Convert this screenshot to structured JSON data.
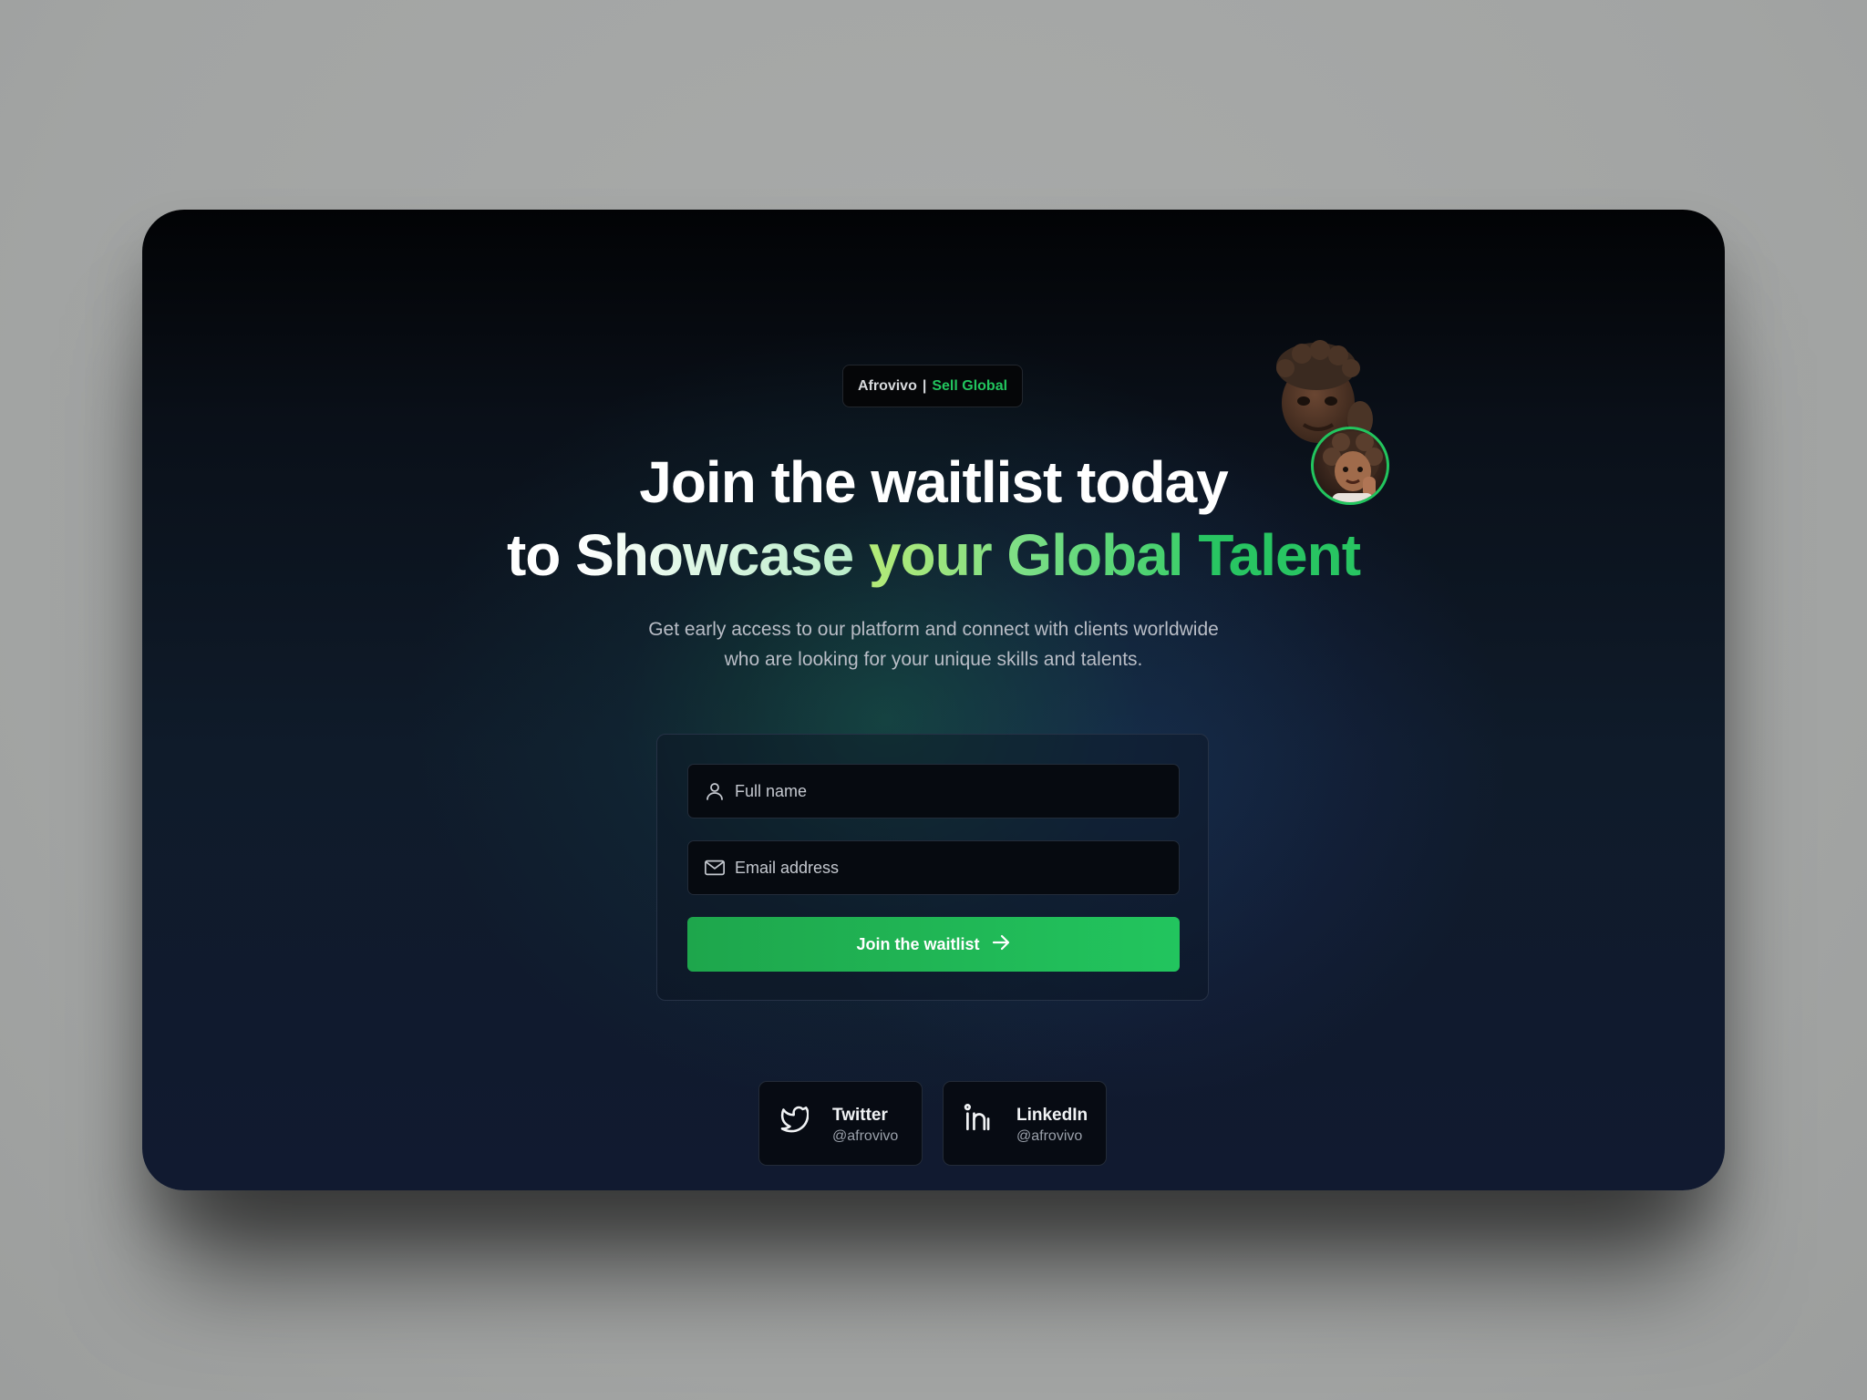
{
  "badge": {
    "brand": "Afrovivo",
    "separator": "|",
    "tagline": "Sell Global"
  },
  "headline": {
    "line1": "Join the waitlist today",
    "line2_parts": [
      "to",
      "Showcase",
      "your Global",
      "Talent"
    ]
  },
  "subtitle": {
    "line1": "Get early access to our platform and connect with clients worldwide",
    "line2": "who are looking for your unique skills and talents."
  },
  "form": {
    "fullname_placeholder": "Full name",
    "email_placeholder": "Email address",
    "submit_label": "Join the waitlist"
  },
  "socials": [
    {
      "name": "Twitter",
      "handle": "@afrovivo",
      "icon": "twitter-icon"
    },
    {
      "name": "LinkedIn",
      "handle": "@afrovivo",
      "icon": "linkedin-icon"
    }
  ],
  "colors": {
    "accent": "#22c55e",
    "background": "#0f1b2a",
    "text_primary": "#ffffff",
    "text_secondary": "#b9bdc6"
  }
}
